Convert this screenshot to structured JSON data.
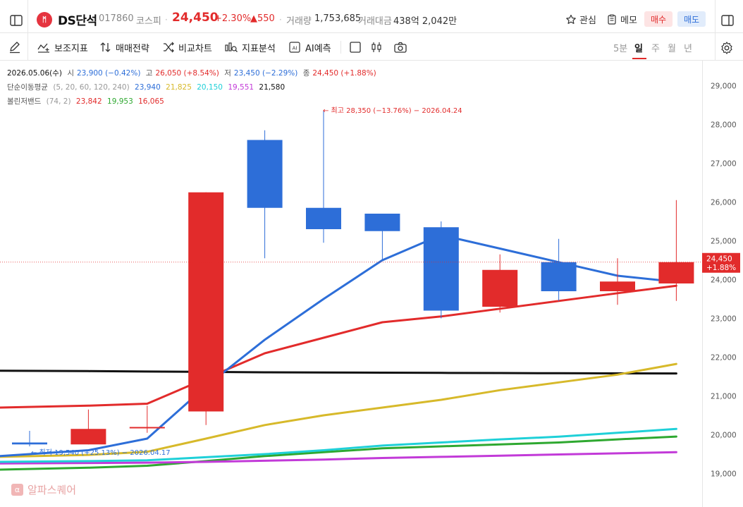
{
  "header": {
    "stock_name": "DS단석",
    "stock_code": "017860",
    "market": "코스피",
    "price": "24,450",
    "change_pct": "+2.30%",
    "change_amt": "▲550",
    "volume_label": "거래량",
    "volume": "1,753,685",
    "value_label": "거래대금",
    "value": "438억 2,042만",
    "watch_label": "관심",
    "memo_label": "메모",
    "buy_label": "매수",
    "sell_label": "매도",
    "logo_text": "ᛗ"
  },
  "toolbar": {
    "indicators_label": "보조지표",
    "strategy_label": "매매전략",
    "compare_label": "비교차트",
    "analysis_label": "지표분석",
    "ai_label": "AI예측",
    "periods": [
      "5분",
      "일",
      "주",
      "월",
      "년"
    ],
    "active_period": "일"
  },
  "info": {
    "date": "2026.05.06(수)",
    "open_label": "시",
    "open": "23,900 (−0.42%)",
    "high_label": "고",
    "high": "26,050 (+8.54%)",
    "low_label": "저",
    "low": "23,450 (−2.29%)",
    "close_label": "종",
    "close": "24,450 (+1.88%)",
    "ma_label": "단순이동평균",
    "ma_params": "(5, 20, 60, 120, 240)",
    "ma_values": [
      "23,940",
      "21,825",
      "20,150",
      "19,551",
      "21,580"
    ],
    "bb_label": "볼린저밴드",
    "bb_params": "(74, 2)",
    "bb_values": [
      "23,842",
      "19,953",
      "16,065"
    ]
  },
  "colors": {
    "up": "#e22b2b",
    "down": "#2d6ed8",
    "ma5": "#2d6ed8",
    "ma20": "#d7b92a",
    "ma60": "#1fd0d8",
    "ma120": "#c23ad8",
    "ma240": "#111111",
    "bb_upper": "#e22b2b",
    "bb_mid": "#2ea830"
  },
  "watermark": "알파스퀘어",
  "chart_data": {
    "type": "candlestick",
    "y_ticks": [
      "29,000",
      "28,000",
      "27,000",
      "26,000",
      "25,000",
      "24,000",
      "23,000",
      "22,000",
      "21,000",
      "20,000",
      "19,000"
    ],
    "ylim": [
      18800,
      29800
    ],
    "candles": [
      {
        "open": 19800,
        "high": 20100,
        "low": 19700,
        "close": 19750
      },
      {
        "open": 19750,
        "high": 20650,
        "low": 19750,
        "close": 20150
      },
      {
        "open": 20200,
        "high": 20750,
        "low": 20050,
        "close": 20200
      },
      {
        "open": 20600,
        "high": 20300,
        "low": 20250,
        "close": 26250
      },
      {
        "open": 27600,
        "high": 27850,
        "low": 24550,
        "close": 25850
      },
      {
        "open": 25850,
        "high": 28350,
        "low": 24950,
        "close": 25300
      },
      {
        "open": 25700,
        "high": 25700,
        "low": 24500,
        "close": 25250
      },
      {
        "open": 25350,
        "high": 25500,
        "low": 23000,
        "close": 23200
      },
      {
        "open": 23300,
        "high": 24650,
        "low": 23150,
        "close": 24250
      },
      {
        "open": 24450,
        "high": 25050,
        "low": 23450,
        "close": 23700
      },
      {
        "open": 23700,
        "high": 24550,
        "low": 23350,
        "close": 23950
      },
      {
        "open": 23900,
        "high": 26050,
        "low": 23450,
        "close": 24450
      }
    ],
    "series": [
      {
        "values": [
          19450,
          19600,
          19900,
          21250,
          22450,
          23500,
          24500,
          25150,
          24800,
          24450,
          24100,
          23940
        ]
      },
      {
        "values": [
          19430,
          19480,
          19560,
          19900,
          20250,
          20500,
          20700,
          20900,
          21150,
          21350,
          21550,
          21825
        ]
      },
      {
        "values": [
          19300,
          19320,
          19340,
          19420,
          19500,
          19600,
          19720,
          19800,
          19880,
          19950,
          20050,
          20150
        ]
      },
      {
        "values": [
          19260,
          19270,
          19280,
          19300,
          19330,
          19360,
          19400,
          19430,
          19460,
          19490,
          19520,
          19551
        ]
      },
      {
        "values": [
          21650,
          21640,
          21630,
          21620,
          21610,
          21605,
          21600,
          21595,
          21590,
          21585,
          21582,
          21580
        ]
      },
      {
        "values": [
          20700,
          20750,
          20800,
          21450,
          22100,
          22500,
          22900,
          23050,
          23250,
          23450,
          23650,
          23842
        ]
      },
      {
        "values": [
          19100,
          19150,
          19200,
          19320,
          19450,
          19550,
          19650,
          19700,
          19750,
          19800,
          19880,
          19953
        ]
      }
    ],
    "annotations": {
      "max_text": "← 최고 28,350 (−13.76%) − 2026.04.24",
      "min_text": "← 최저 19,540 (+25.13%) − 2026.04.17",
      "last_price": "24,450",
      "last_pct": "+1.88%"
    }
  }
}
